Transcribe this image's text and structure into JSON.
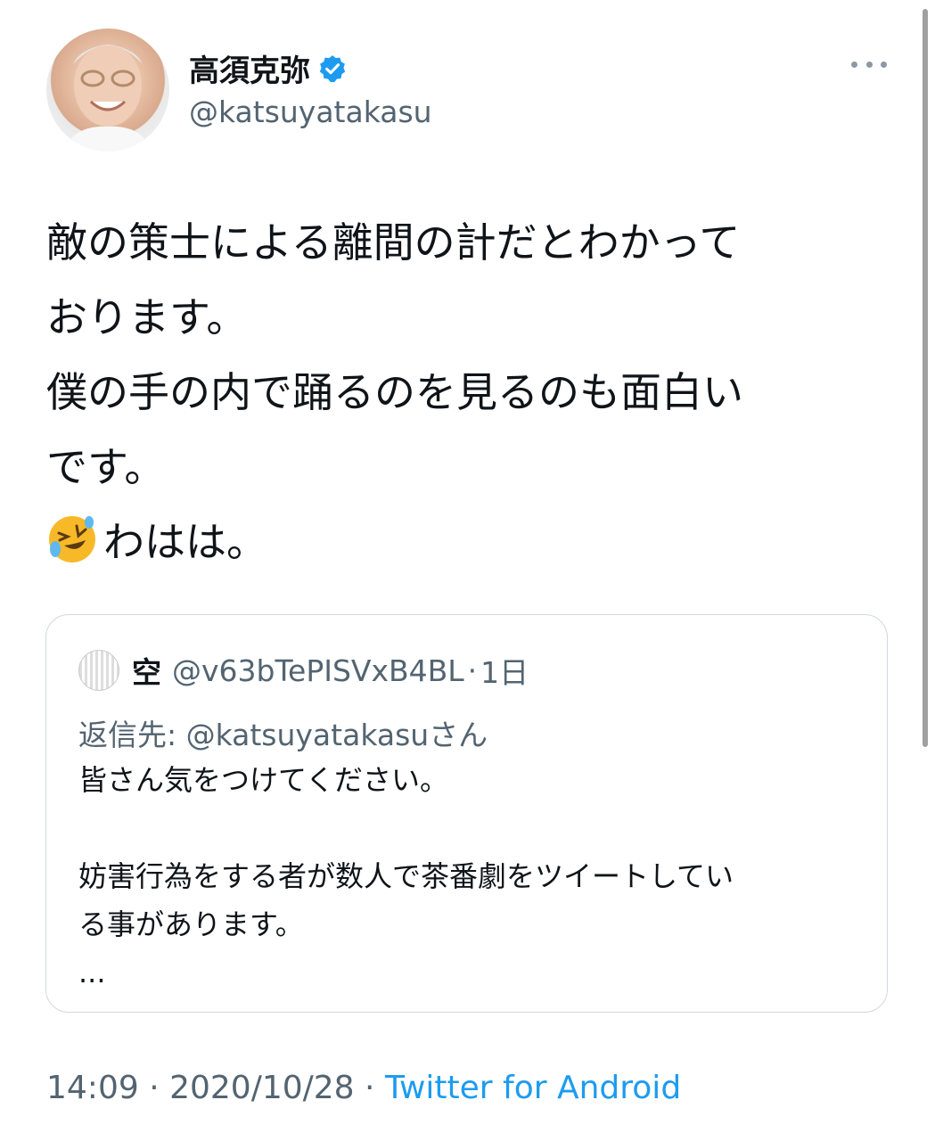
{
  "author": {
    "display_name": "高須克弥",
    "handle": "@katsuyatakasu",
    "verified_icon": "verified-badge-icon"
  },
  "tweet": {
    "lines": [
      "敵の策士による離間の計だとわかって",
      "おります。",
      "僕の手の内で踊るのを見るのも面白い",
      "です。",
      "わはは。"
    ],
    "emoji": "rolling-on-floor-laughing-emoji"
  },
  "quoted_tweet": {
    "display_name": "空",
    "handle": "@v63bTePISVxB4BL",
    "separator": "·",
    "time": "1日",
    "reply_to": "返信先: @katsuyatakasuさん",
    "body_lines": [
      "皆さん気をつけてください。",
      "",
      "妨害行為をする者が数人で茶番劇をツイートしてい",
      "る事があります。",
      "..."
    ]
  },
  "meta": {
    "time": "14:09",
    "dot1": " · ",
    "date": "2020/10/28",
    "dot2": " · ",
    "source": "Twitter for Android"
  },
  "colors": {
    "text": "#0f1419",
    "secondary": "#536471",
    "accent": "#1d9bf0",
    "border": "#cfd9de"
  }
}
